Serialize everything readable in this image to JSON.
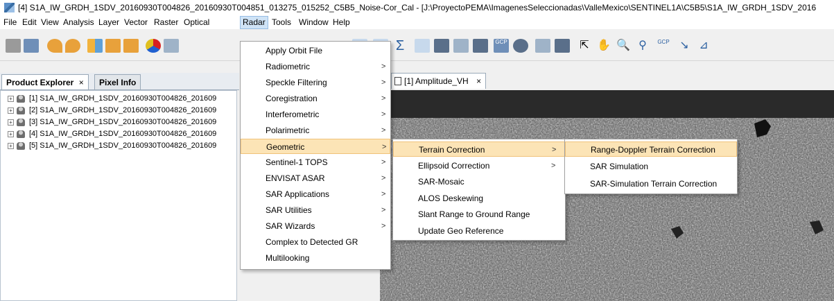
{
  "window": {
    "title": "[4] S1A_IW_GRDH_1SDV_20160930T004826_20160930T004851_013275_015252_C5B5_Noise-Cor_Cal - [J:\\ProyectoPEMA\\ImagenesSeleccionadas\\ValleMexico\\SENTINEL1A\\C5B5\\S1A_IW_GRDH_1SDV_2016"
  },
  "menubar": {
    "items": [
      "File",
      "Edit",
      "View",
      "Analysis",
      "Layer",
      "Vector",
      "Raster",
      "Optical",
      "Radar",
      "Tools",
      "Window",
      "Help"
    ],
    "active": "Radar"
  },
  "panel": {
    "tabs": [
      "Product Explorer",
      "Pixel Info"
    ],
    "close_glyph": "×",
    "products": [
      "[1] S1A_IW_GRDH_1SDV_20160930T004826_201609",
      "[2] S1A_IW_GRDH_1SDV_20160930T004826_201609",
      "[3] S1A_IW_GRDH_1SDV_20160930T004826_201609",
      "[4] S1A_IW_GRDH_1SDV_20160930T004826_201609",
      "[5] S1A_IW_GRDH_1SDV_20160930T004826_201609"
    ]
  },
  "document": {
    "tab_label": "[1] Amplitude_VH",
    "close_glyph": "×"
  },
  "radar_menu": {
    "items": [
      {
        "label": "Apply Orbit File",
        "submenu": false
      },
      {
        "label": "Radiometric",
        "submenu": true
      },
      {
        "label": "Speckle Filtering",
        "submenu": true
      },
      {
        "label": "Coregistration",
        "submenu": true
      },
      {
        "label": "Interferometric",
        "submenu": true
      },
      {
        "label": "Polarimetric",
        "submenu": true
      },
      {
        "label": "Geometric",
        "submenu": true,
        "highlighted": true
      },
      {
        "label": "Sentinel-1 TOPS",
        "submenu": true
      },
      {
        "label": "ENVISAT ASAR",
        "submenu": true
      },
      {
        "label": "SAR Applications",
        "submenu": true
      },
      {
        "label": "SAR Utilities",
        "submenu": true
      },
      {
        "label": "SAR Wizards",
        "submenu": true
      },
      {
        "label": "Complex to Detected GR",
        "submenu": false
      },
      {
        "label": "Multilooking",
        "submenu": false
      }
    ]
  },
  "geometric_menu": {
    "items": [
      {
        "label": "Terrain Correction",
        "submenu": true,
        "highlighted": true
      },
      {
        "label": "Ellipsoid Correction",
        "submenu": true
      },
      {
        "label": "SAR-Mosaic",
        "submenu": false
      },
      {
        "label": "ALOS Deskewing",
        "submenu": false
      },
      {
        "label": "Slant Range to Ground Range",
        "submenu": false
      },
      {
        "label": "Update Geo Reference",
        "submenu": false
      }
    ]
  },
  "terrain_menu": {
    "items": [
      {
        "label": "Range-Doppler Terrain Correction",
        "highlighted": true
      },
      {
        "label": "SAR Simulation"
      },
      {
        "label": "SAR-Simulation Terrain Correction"
      }
    ]
  },
  "toolbar": {
    "icons": [
      "open-product-icon",
      "save-product-icon",
      "undo-icon",
      "redo-icon",
      "graph-builder-icon",
      "batch-processing-icon",
      "bands-icon",
      "rgb-image-icon",
      "wizard-icon",
      "band-maths-icon",
      "sigma-icon",
      "filter-icon",
      "mask-icon",
      "grid-icon",
      "pin-icon",
      "gcp-icon",
      "region-icon",
      "tie-point-icon",
      "select-icon",
      "pan-icon",
      "zoom-icon",
      "pin-placing-icon",
      "gcp-placing-icon",
      "line-draw-icon"
    ],
    "gcp_label": "GCP"
  },
  "arrow_glyph": ">"
}
